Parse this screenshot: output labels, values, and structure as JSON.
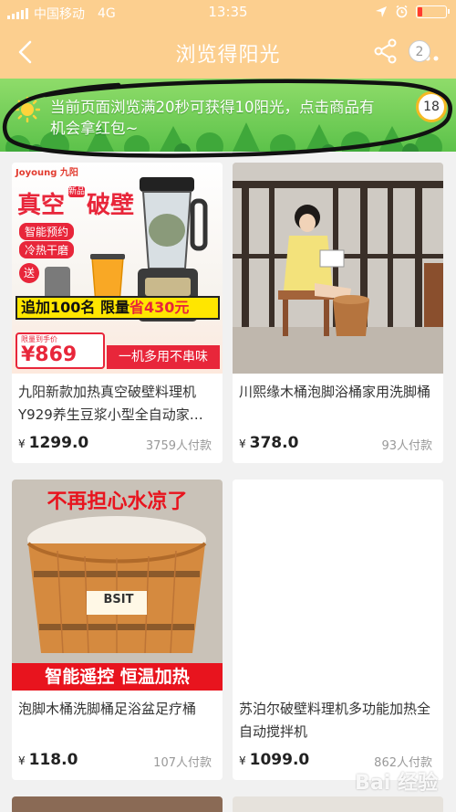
{
  "status": {
    "carrier": "中国移动",
    "network": "4G",
    "time": "13:35"
  },
  "nav": {
    "title": "浏览得阳光",
    "badge": "2"
  },
  "banner": {
    "text": "当前页面浏览满20秒可获得10阳光，点击商品有机会拿红包~",
    "timer": "18"
  },
  "colors": {
    "header": "#fccf8f",
    "banner": "#6ccc52",
    "price": "#222222"
  },
  "products": [
    {
      "title": "九阳新款加热真空破壁料理机Y929养生豆浆小型全自动家…",
      "currency": "¥",
      "price": "1299.0",
      "sold": "3759人付款",
      "image_text": {
        "brand": "Joyoung 九阳",
        "headline_a": "真空",
        "headline_tag": "新品",
        "headline_b": "破壁",
        "feature1": "智能预约",
        "feature2": "冷热干磨",
        "gift": "送",
        "promo_a": "追加100名 限量",
        "promo_b": "省430元",
        "limit_label": "限量到手价",
        "limit_price": "¥869",
        "slogan": "一机多用不串味"
      }
    },
    {
      "title": "川熙缘木桶泡脚浴桶家用洗脚桶",
      "currency": "¥",
      "price": "378.0",
      "sold": "93人付款"
    },
    {
      "title": "泡脚木桶洗脚桶足浴盆足疗桶",
      "currency": "¥",
      "price": "118.0",
      "sold": "107人付款",
      "image_text": {
        "top": "不再担心水凉了",
        "bottom": "智能遥控 恒温加热",
        "brand": "BSIT"
      }
    },
    {
      "title": "苏泊尔破壁料理机多功能加热全自动搅拌机",
      "currency": "¥",
      "price": "1099.0",
      "sold": "862人付款"
    }
  ],
  "watermark": "Bai 经验"
}
